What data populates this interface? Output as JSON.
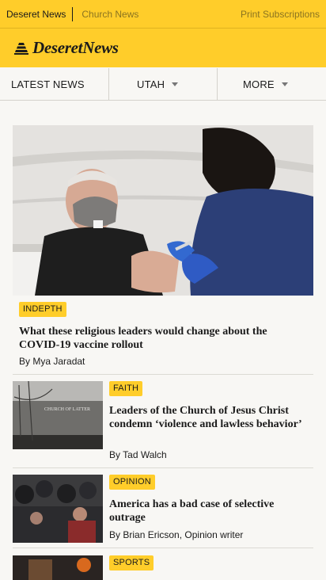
{
  "topbar": {
    "site": "Deseret News",
    "church": "Church News",
    "print": "Print Subscriptions"
  },
  "brand": {
    "logo_text": "DeseretNews"
  },
  "nav": {
    "latest": "LATEST NEWS",
    "utah": "UTAH",
    "more": "MORE"
  },
  "hero": {
    "tag": "INDEPTH",
    "headline": "What these religious leaders would change about the COVID-19 vaccine rollout",
    "by": "By",
    "author": "Mya Jaradat"
  },
  "stories": [
    {
      "tag": "FAITH",
      "headline": "Leaders of the Church of Jesus Christ condemn ‘violence and lawless behavior’",
      "by": "By",
      "author": "Tad Walch"
    },
    {
      "tag": "OPINION",
      "headline": "America has a bad case of selective outrage",
      "by": "By",
      "author": "Brian Ericson, Opinion writer"
    },
    {
      "tag": "SPORTS"
    }
  ],
  "colors": {
    "brand_yellow": "#ffcd2a",
    "text": "#1b1b1b",
    "background": "#f8f7f4"
  },
  "icons": {
    "logo": "beehive-icon",
    "dropdown": "caret-down-icon"
  }
}
